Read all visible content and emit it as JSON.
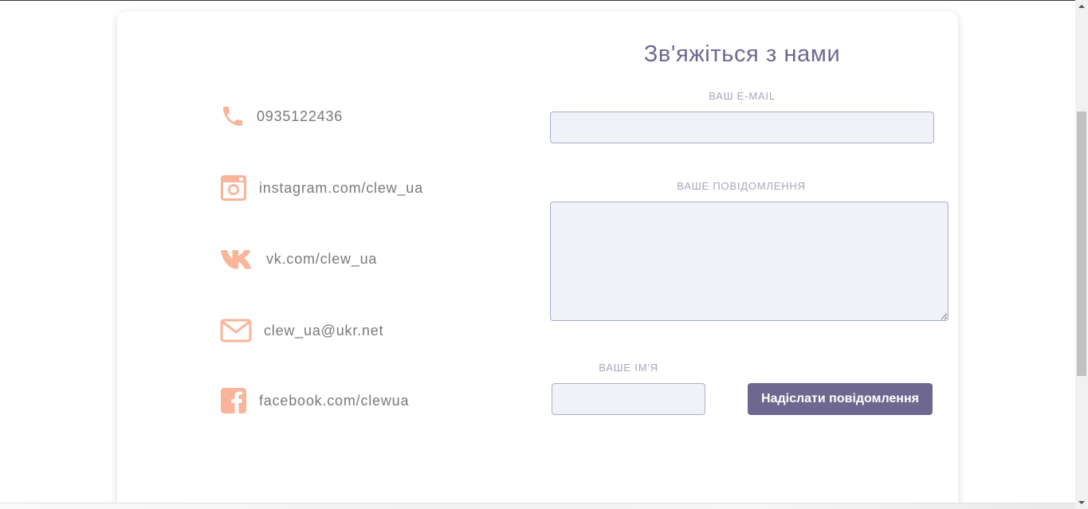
{
  "contacts": {
    "phone": {
      "text": "0935122436",
      "icon": "phone-icon"
    },
    "instagram": {
      "text": "instagram.com/clew_ua",
      "icon": "instagram-icon"
    },
    "vk": {
      "text": "vk.com/clew_ua",
      "icon": "vk-icon"
    },
    "email": {
      "text": "clew_ua@ukr.net",
      "icon": "envelope-icon"
    },
    "facebook": {
      "text": "facebook.com/clewua",
      "icon": "facebook-icon"
    }
  },
  "form": {
    "title": "Зв'яжіться з нами",
    "email_label": "ВАШ E-MAIL",
    "email_value": "",
    "message_label": "ВАШЕ ПОВІДОМЛЕННЯ",
    "message_value": "",
    "name_label": "ВАШЕ ІМ'Я",
    "name_value": "",
    "submit_label": "Надіслати повідомлення"
  },
  "colors": {
    "accent_icon": "#f9b49a",
    "title": "#6e6891",
    "button": "#6e6891",
    "field_bg": "#f0f2f7",
    "label": "#a4a7b8"
  }
}
